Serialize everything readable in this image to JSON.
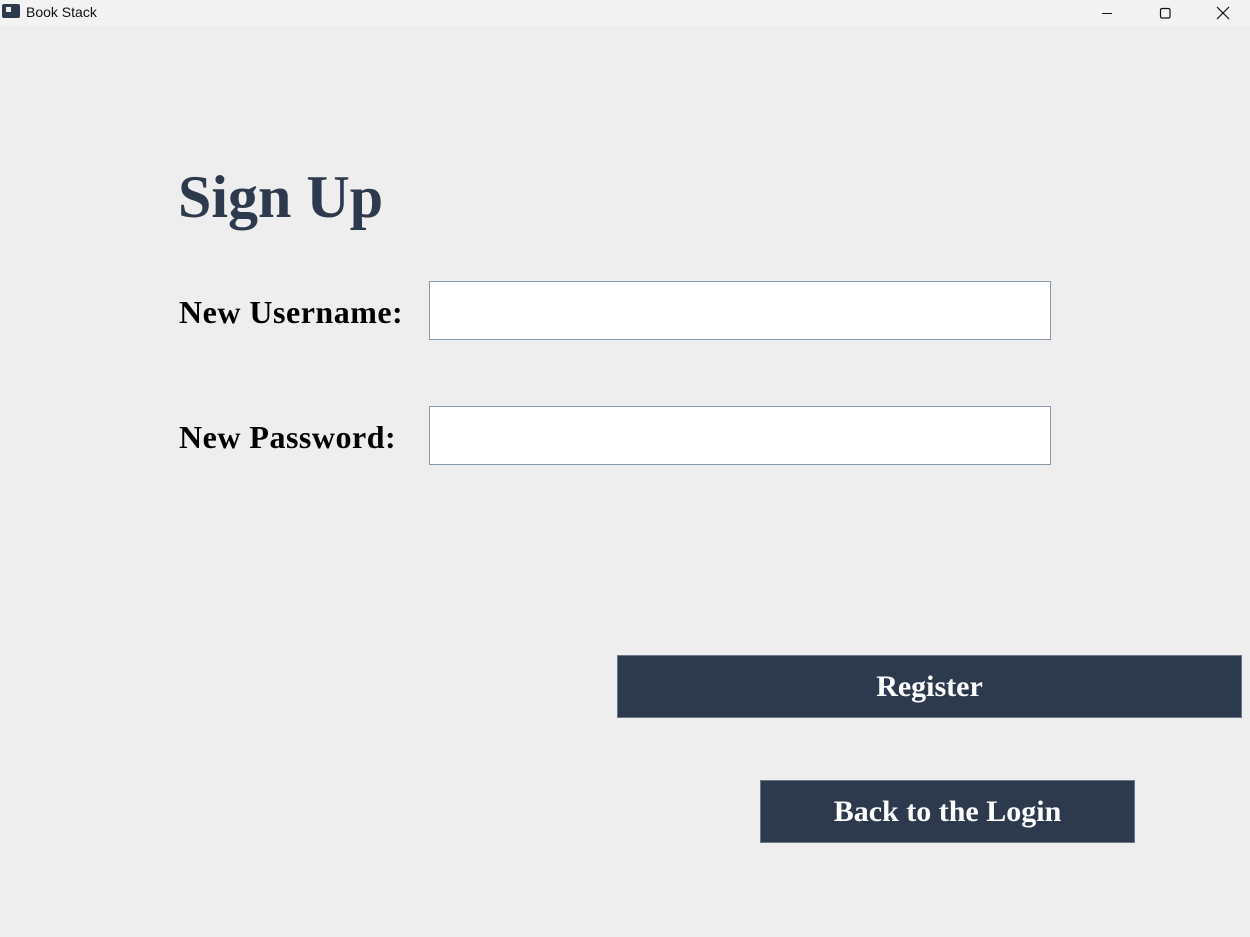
{
  "window": {
    "title": "Book Stack",
    "app_icon": "book-stack-app-icon",
    "controls": {
      "minimize_icon": "minimize-icon",
      "maximize_icon": "maximize-icon",
      "close_icon": "close-icon"
    }
  },
  "form": {
    "heading": "Sign Up",
    "username_label": "New Username:",
    "username_value": "",
    "password_label": "New Password:",
    "password_value": "",
    "register_label": "Register",
    "back_label": "Back to the Login"
  },
  "colors": {
    "accent": "#2d3a4e",
    "background": "#eeeeee",
    "button_text": "#ffffff",
    "input_background": "#ffffff"
  }
}
